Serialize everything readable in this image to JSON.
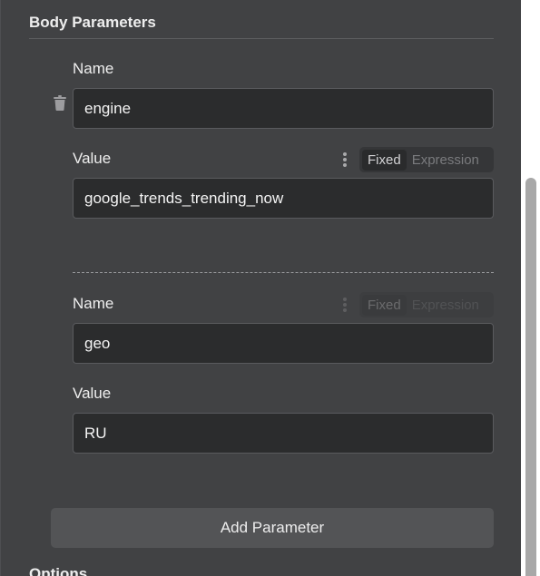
{
  "section": {
    "title": "Body Parameters",
    "next_title": "Options"
  },
  "parameters": [
    {
      "name_label": "Name",
      "name_value": "engine",
      "value_label": "Value",
      "value_value": "google_trends_trending_now",
      "mode_options": [
        "Fixed",
        "Expression"
      ],
      "mode_selected": "Fixed"
    },
    {
      "name_label": "Name",
      "name_value": "geo",
      "value_label": "Value",
      "value_value": "RU",
      "mode_options": [
        "Fixed",
        "Expression"
      ],
      "mode_selected": "Fixed"
    }
  ],
  "add_button_label": "Add Parameter",
  "icons": {
    "delete": "trash-icon",
    "options": "kebab-menu-icon"
  },
  "colors": {
    "panel_bg": "#414244",
    "input_bg": "#2b2c2d",
    "button_bg": "#535456",
    "text": "#eeeeee"
  }
}
